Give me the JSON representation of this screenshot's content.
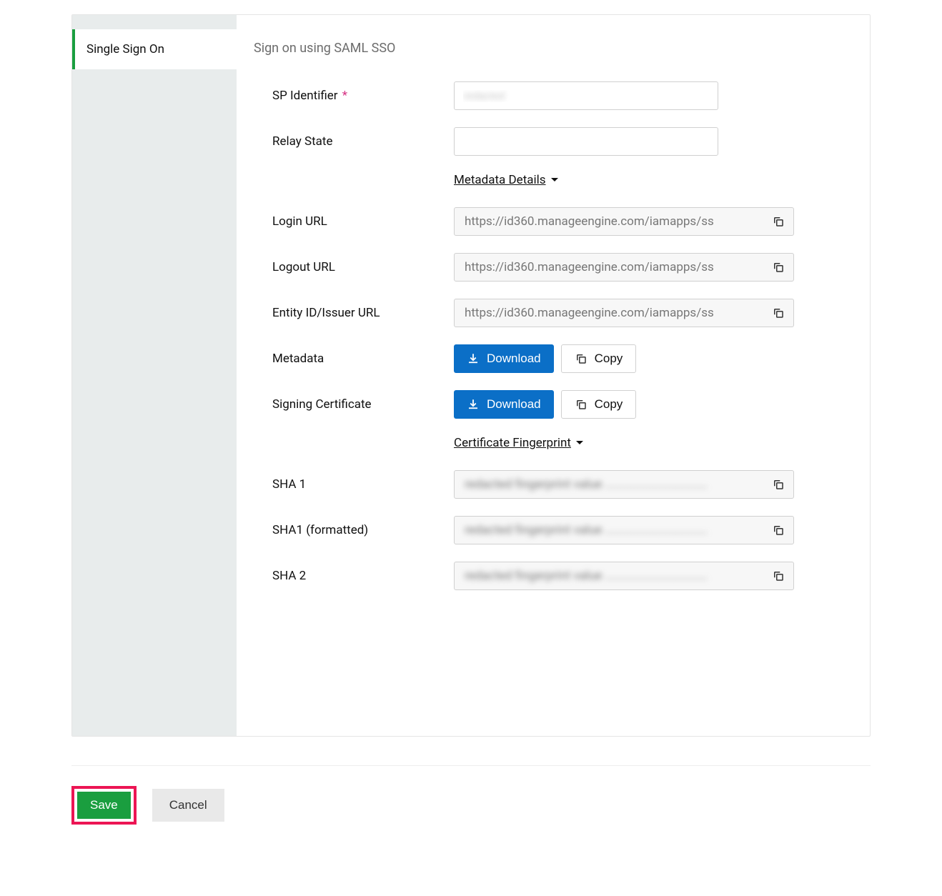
{
  "sidebar": {
    "items": [
      {
        "label": "Single Sign On"
      }
    ]
  },
  "main": {
    "subtitle": "Sign on using SAML SSO",
    "labels": {
      "sp_identifier": "SP Identifier",
      "relay_state": "Relay State",
      "login_url": "Login URL",
      "logout_url": "Logout URL",
      "entity_id": "Entity ID/Issuer URL",
      "metadata": "Metadata",
      "signing_cert": "Signing Certificate",
      "sha1": "SHA 1",
      "sha1_formatted": "SHA1 (formatted)",
      "sha2": "SHA 2"
    },
    "disclosures": {
      "metadata_details": "Metadata Details",
      "cert_fingerprint": "Certificate Fingerprint"
    },
    "values": {
      "sp_identifier": "redacted",
      "relay_state": "",
      "login_url": "https://id360.manageengine.com/iamapps/ss",
      "logout_url": "https://id360.manageengine.com/iamapps/ss",
      "entity_id": "https://id360.manageengine.com/iamapps/ss",
      "sha1": "redacted fingerprint value ................................",
      "sha1_formatted": "redacted fingerprint value ................................",
      "sha2": "redacted fingerprint value ................................"
    },
    "buttons": {
      "download": "Download",
      "copy": "Copy"
    }
  },
  "footer": {
    "save": "Save",
    "cancel": "Cancel"
  }
}
